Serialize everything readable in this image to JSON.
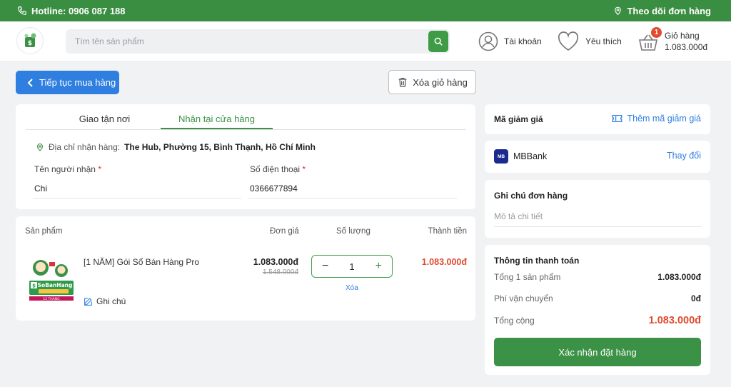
{
  "topbar": {
    "hotline": "Hotline: 0906 087 188",
    "track": "Theo dõi đơn hàng"
  },
  "header": {
    "search_placeholder": "Tìm tên sản phẩm",
    "account": "Tài khoản",
    "wishlist": "Yêu thích",
    "cart_label": "Giỏ hàng",
    "cart_total": "1.083.000đ",
    "cart_count": "1"
  },
  "actions": {
    "continue": "Tiếp tục mua hàng",
    "clear": "Xóa giỏ hàng"
  },
  "delivery": {
    "tabs": [
      "Giao tận nơi",
      "Nhận tại cửa hàng"
    ],
    "active_tab": 1,
    "address_label": "Địa chỉ nhận hàng:",
    "address_value": "The Hub, Phường 15, Bình Thạnh, Hồ Chí Minh",
    "name_label": "Tên người nhận",
    "name_value": "Chi",
    "phone_label": "Số điện thoại",
    "phone_value": "0366677894",
    "required_mark": "*"
  },
  "cart": {
    "headers": {
      "product": "Sản phẩm",
      "unit_price": "Đơn giá",
      "quantity": "Số lượng",
      "total": "Thành tiền"
    },
    "items": [
      {
        "name": "[1 NĂM] Gói Sổ Bán Hàng Pro",
        "price": "1.083.000đ",
        "old_price": "1.548.000đ",
        "quantity": "1",
        "total": "1.083.000đ",
        "note": "Ghi chú",
        "remove": "Xóa",
        "image_text": "SoBanHang",
        "image_sub": "12 THÁNG"
      }
    ]
  },
  "coupon": {
    "title": "Mã giảm giá",
    "add": "Thêm mã giảm giá"
  },
  "payment_method": {
    "name": "MBBank",
    "logo": "MB",
    "change": "Thay đổi"
  },
  "order_note": {
    "title": "Ghi chú đơn hàng",
    "placeholder": "Mô tả chi tiết"
  },
  "summary": {
    "title": "Thông tin thanh toán",
    "subtotal_label": "Tổng 1 sản phẩm",
    "subtotal_value": "1.083.000đ",
    "shipping_label": "Phí vận chuyển",
    "shipping_value": "0đ",
    "grand_label": "Tổng cộng",
    "grand_value": "1.083.000đ",
    "confirm": "Xác nhận đặt hàng"
  },
  "colors": {
    "brand_green": "#3a8e42",
    "accent_blue": "#2f7fe0",
    "price_red": "#e04a2e"
  }
}
